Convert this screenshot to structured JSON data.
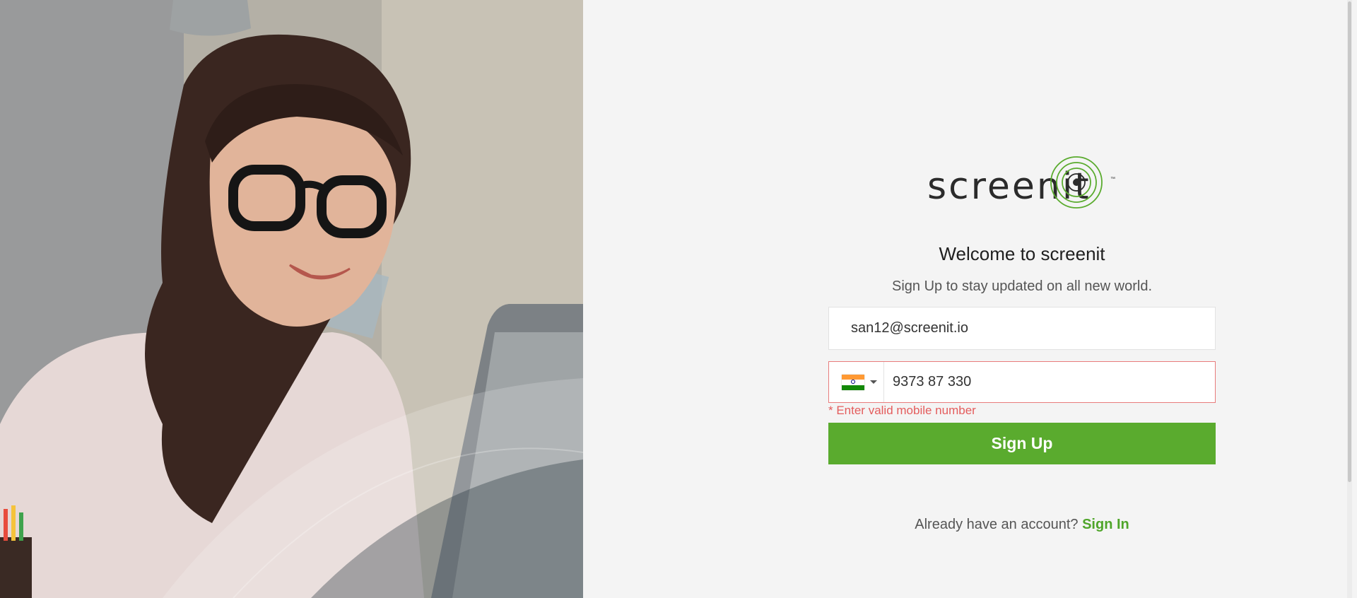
{
  "brand": {
    "logo_text": "screenit",
    "trademark": "™",
    "accent_color": "#5aab2e",
    "error_color": "#e45d5d"
  },
  "hero": {
    "image_description_icon": "woman-with-glasses-photo"
  },
  "form": {
    "welcome_title": "Welcome to screenit",
    "subtitle": "Sign Up to stay updated on all new world.",
    "email_value": "san12@screenit.io",
    "country_flag": "india-flag-icon",
    "phone_value": "9373 87 330",
    "error_message": "* Enter valid mobile number",
    "signup_label": "Sign Up"
  },
  "footer": {
    "already_text": "Already have an account?",
    "signin_label": "Sign In"
  }
}
